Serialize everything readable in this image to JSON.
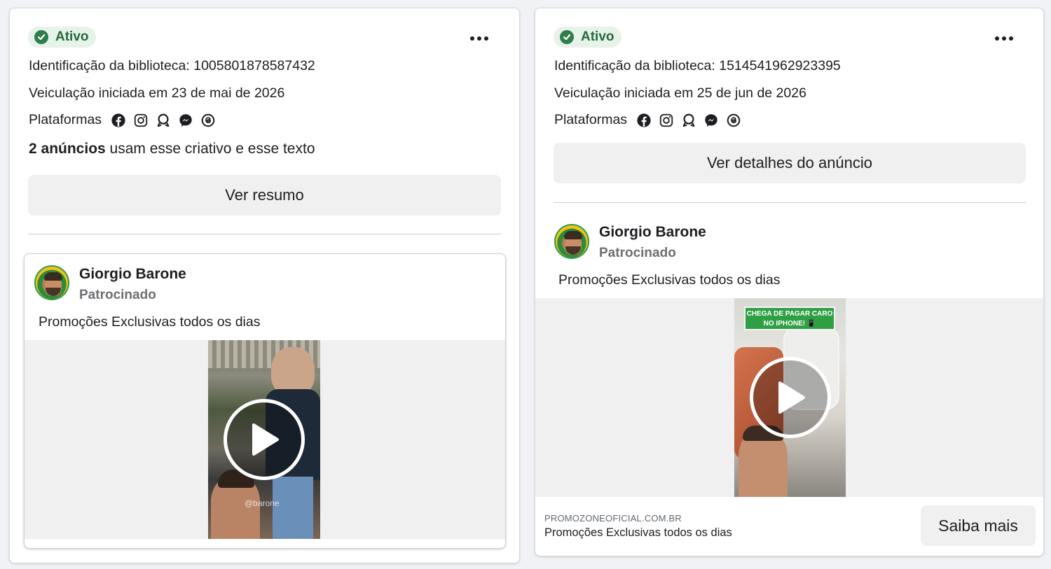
{
  "colors": {
    "active_green": "#2e7d4b",
    "active_bg": "#e7f3e9",
    "button_gray": "#f0f0f0"
  },
  "cards": [
    {
      "status": "Ativo",
      "library_id_text": "Identificação da biblioteca: 1005801878587432",
      "started_text": "Veiculação iniciada em 23 de mai de 2026",
      "platforms_label": "Plataformas",
      "platform_icons": [
        "facebook-icon",
        "instagram-icon",
        "audience-network-icon",
        "messenger-icon",
        "threads-icon"
      ],
      "usage_bold": "2 anúncios",
      "usage_rest": " usam esse criativo e esse texto",
      "button_label": "Ver resumo",
      "ad": {
        "advertiser": "Giorgio Barone",
        "sponsored": "Patrocinado",
        "text": "Promoções Exclusivas todos os dias",
        "watermark": "@barone"
      }
    },
    {
      "status": "Ativo",
      "library_id_text": "Identificação da biblioteca: 1514541962923395",
      "started_text": "Veiculação iniciada em 25 de jun de 2026",
      "platforms_label": "Plataformas",
      "platform_icons": [
        "facebook-icon",
        "instagram-icon",
        "audience-network-icon",
        "messenger-icon",
        "threads-icon"
      ],
      "button_label": "Ver detalhes do anúncio",
      "ad": {
        "advertiser": "Giorgio Barone",
        "sponsored": "Patrocinado",
        "text": "Promoções Exclusivas todos os dias",
        "thumb_caption_line1": "CHEGA DE PAGAR CARO",
        "thumb_caption_line2": "NO IPHONE! 📱",
        "link_domain": "PROMOZONEOFICIAL.COM.BR",
        "link_title": "Promoções Exclusivas todos os dias",
        "cta": "Saiba mais"
      }
    }
  ]
}
